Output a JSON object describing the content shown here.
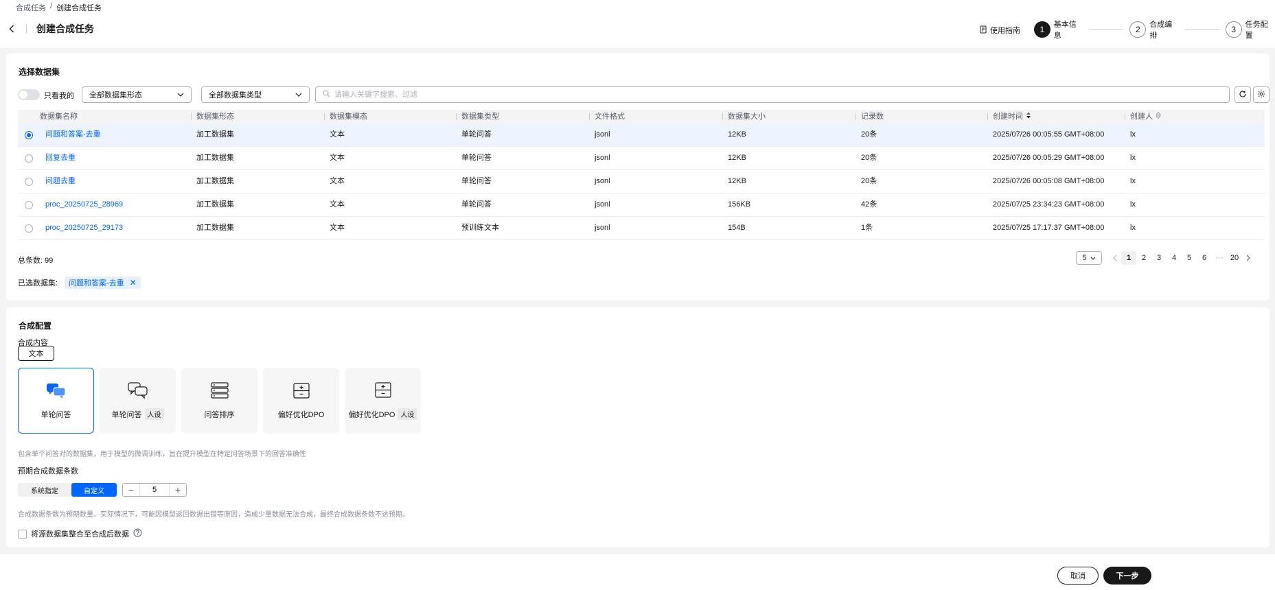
{
  "breadcrumb": {
    "parent": "合成任务",
    "separator": "/",
    "current": "创建合成任务"
  },
  "page_title": "创建合成任务",
  "guide_label": "使用指南",
  "steps": [
    {
      "num": "1",
      "label": "基本信息"
    },
    {
      "num": "2",
      "label": "合成编排"
    },
    {
      "num": "3",
      "label": "任务配置"
    }
  ],
  "dataset": {
    "title": "选择数据集",
    "only_mine_label": "只看我的",
    "form_select": "全部数据集形态",
    "type_select": "全部数据集类型",
    "search_placeholder": "请输入关键字搜索、过滤",
    "columns": [
      "数据集名称",
      "数据集形态",
      "数据集模态",
      "数据集类型",
      "文件格式",
      "数据集大小",
      "记录数",
      "创建时间",
      "创建人"
    ],
    "rows": [
      {
        "name": "问题和答案-去重",
        "form": "加工数据集",
        "modal": "文本",
        "type": "单轮问答",
        "format": "jsonl",
        "size": "12KB",
        "records": "20条",
        "created": "2025/07/26 00:05:55 GMT+08:00",
        "creator": "lx"
      },
      {
        "name": "回复去重",
        "form": "加工数据集",
        "modal": "文本",
        "type": "单轮问答",
        "format": "jsonl",
        "size": "12KB",
        "records": "20条",
        "created": "2025/07/26 00:05:29 GMT+08:00",
        "creator": "lx"
      },
      {
        "name": "问题去重",
        "form": "加工数据集",
        "modal": "文本",
        "type": "单轮问答",
        "format": "jsonl",
        "size": "12KB",
        "records": "20条",
        "created": "2025/07/26 00:05:08 GMT+08:00",
        "creator": "lx"
      },
      {
        "name": "proc_20250725_28969",
        "form": "加工数据集",
        "modal": "文本",
        "type": "单轮问答",
        "format": "jsonl",
        "size": "156KB",
        "records": "42条",
        "created": "2025/07/25 23:34:23 GMT+08:00",
        "creator": "lx"
      },
      {
        "name": "proc_20250725_29173",
        "form": "加工数据集",
        "modal": "文本",
        "type": "预训练文本",
        "format": "jsonl",
        "size": "154B",
        "records": "1条",
        "created": "2025/07/25 17:17:37 GMT+08:00",
        "creator": "lx"
      }
    ],
    "total_label": "总条数: 99",
    "page_size": "5",
    "pages": [
      "1",
      "2",
      "3",
      "4",
      "5",
      "6",
      "···",
      "20"
    ],
    "current_page": "1",
    "chosen_label": "已选数据集:",
    "chosen_tag": "问题和答案-去重"
  },
  "synth": {
    "title": "合成配置",
    "content_label": "合成内容",
    "content_button": "文本",
    "tiles": [
      {
        "label": "单轮问答",
        "badge": "",
        "icon": "chat-bubbles-icon"
      },
      {
        "label": "单轮问答",
        "badge": "人设",
        "icon": "chat-outline-icon"
      },
      {
        "label": "问答排序",
        "badge": "",
        "icon": "stack-list-icon"
      },
      {
        "label": "偏好优化DPO",
        "badge": "",
        "icon": "compare-box-icon"
      },
      {
        "label": "偏好优化DPO",
        "badge": "人设",
        "icon": "compare-box-icon"
      }
    ],
    "tile_hint": "包含单个问答对的数据集，用于模型的微调训练，旨在提升模型在特定问答场景下的回答准确性",
    "expected_label": "预期合成数据条数",
    "seg_system": "系统指定",
    "seg_custom": "自定义",
    "count_value": "5",
    "count_hint": "合成数据条数为预期数量。实际情况下，可能因模型返回数据出错等原因，造成少量数据无法合成，最终合成数据条数不达预期。",
    "merge_label": "将源数据集整合至合成后数据"
  },
  "footer": {
    "cancel": "取消",
    "next": "下一步"
  },
  "colors": {
    "accent": "#0066ff",
    "dark": "#191919",
    "selected_row": "#eef4ff"
  }
}
